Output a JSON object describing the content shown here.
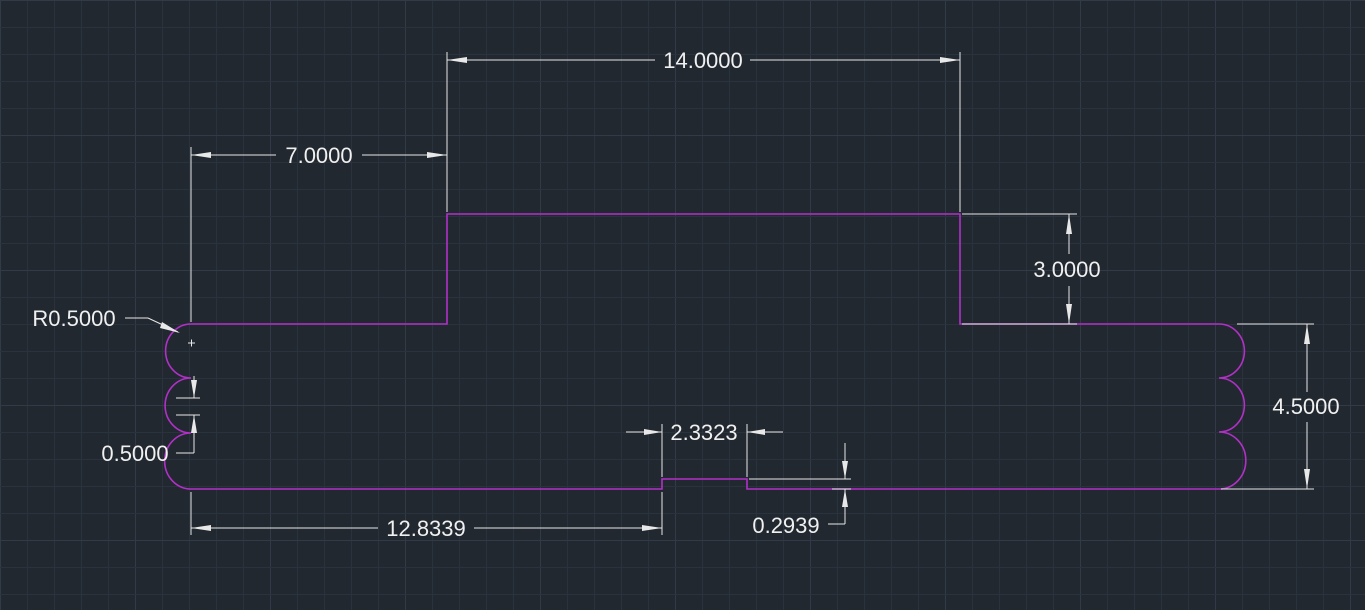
{
  "colors": {
    "background": "#212830",
    "grid": "#2a323d",
    "profile": "#b230c8",
    "dimension": "#e8e8e8"
  },
  "dimensions": {
    "overall_top_width": "14.0000",
    "left_step_width": "7.0000",
    "step_height": "3.0000",
    "right_height": "4.5000",
    "radius": "R0.5000",
    "left_spacing": "0.5000",
    "notch_width": "2.3323",
    "notch_depth": "0.2939",
    "notch_offset": "12.8339"
  }
}
